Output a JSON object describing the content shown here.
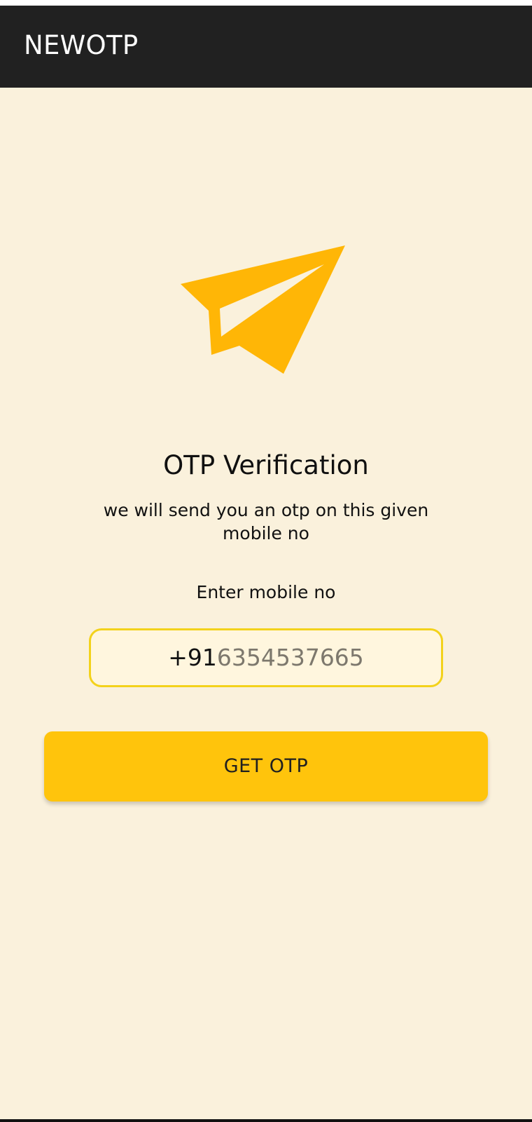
{
  "app_bar": {
    "title": "NEWOTP"
  },
  "hero": {
    "icon": "paper-plane-icon",
    "color": "#FFB606"
  },
  "verification": {
    "heading": "OTP Verification",
    "subtext": "we will send you an otp on this given mobile no",
    "field_label": "Enter mobile no",
    "phone_prefix": "+91",
    "phone_number": "6354537665",
    "button_label": "GET OTP"
  },
  "colors": {
    "background": "#FAF1DC",
    "app_bar": "#212121",
    "accent": "#FFC40C",
    "field_border": "#F3D21B"
  }
}
